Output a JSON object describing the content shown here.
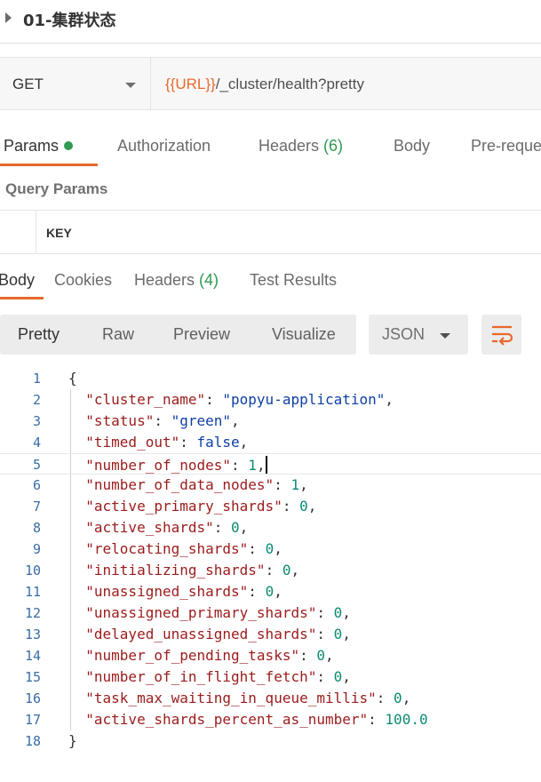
{
  "request": {
    "title": "01-集群状态",
    "method": "GET",
    "url_var": "{{URL}}",
    "url_path": "/_cluster/health?pretty"
  },
  "request_tabs": [
    {
      "label": "Params",
      "active": true
    },
    {
      "label": "Authorization"
    },
    {
      "label": "Headers ",
      "count": "(6)"
    },
    {
      "label": "Body"
    },
    {
      "label": "Pre-reque"
    }
  ],
  "query_params": {
    "title": "Query Params",
    "key_header": "KEY"
  },
  "response_tabs": [
    {
      "label": "Body",
      "active": true
    },
    {
      "label": "Cookies"
    },
    {
      "label": "Headers ",
      "count": "(4)"
    },
    {
      "label": "Test Results"
    }
  ],
  "format_tabs": [
    {
      "label": "Pretty",
      "active": true
    },
    {
      "label": "Raw"
    },
    {
      "label": "Preview"
    },
    {
      "label": "Visualize"
    }
  ],
  "format_select": "JSON",
  "icons": {
    "caret": "expand-caret-icon",
    "wrap": "wrap-lines-icon"
  },
  "colors": {
    "accent": "#e8692c",
    "success": "#2e9b51"
  },
  "response_body": [
    {
      "key": "cluster_name",
      "value": "\"popyu-application\"",
      "type": "string"
    },
    {
      "key": "status",
      "value": "\"green\"",
      "type": "string"
    },
    {
      "key": "timed_out",
      "value": "false",
      "type": "bool"
    },
    {
      "key": "number_of_nodes",
      "value": "1",
      "type": "number"
    },
    {
      "key": "number_of_data_nodes",
      "value": "1",
      "type": "number"
    },
    {
      "key": "active_primary_shards",
      "value": "0",
      "type": "number"
    },
    {
      "key": "active_shards",
      "value": "0",
      "type": "number"
    },
    {
      "key": "relocating_shards",
      "value": "0",
      "type": "number"
    },
    {
      "key": "initializing_shards",
      "value": "0",
      "type": "number"
    },
    {
      "key": "unassigned_shards",
      "value": "0",
      "type": "number"
    },
    {
      "key": "unassigned_primary_shards",
      "value": "0",
      "type": "number"
    },
    {
      "key": "delayed_unassigned_shards",
      "value": "0",
      "type": "number"
    },
    {
      "key": "number_of_pending_tasks",
      "value": "0",
      "type": "number"
    },
    {
      "key": "number_of_in_flight_fetch",
      "value": "0",
      "type": "number"
    },
    {
      "key": "task_max_waiting_in_queue_millis",
      "value": "0",
      "type": "number"
    },
    {
      "key": "active_shards_percent_as_number",
      "value": "100.0",
      "type": "number"
    }
  ]
}
